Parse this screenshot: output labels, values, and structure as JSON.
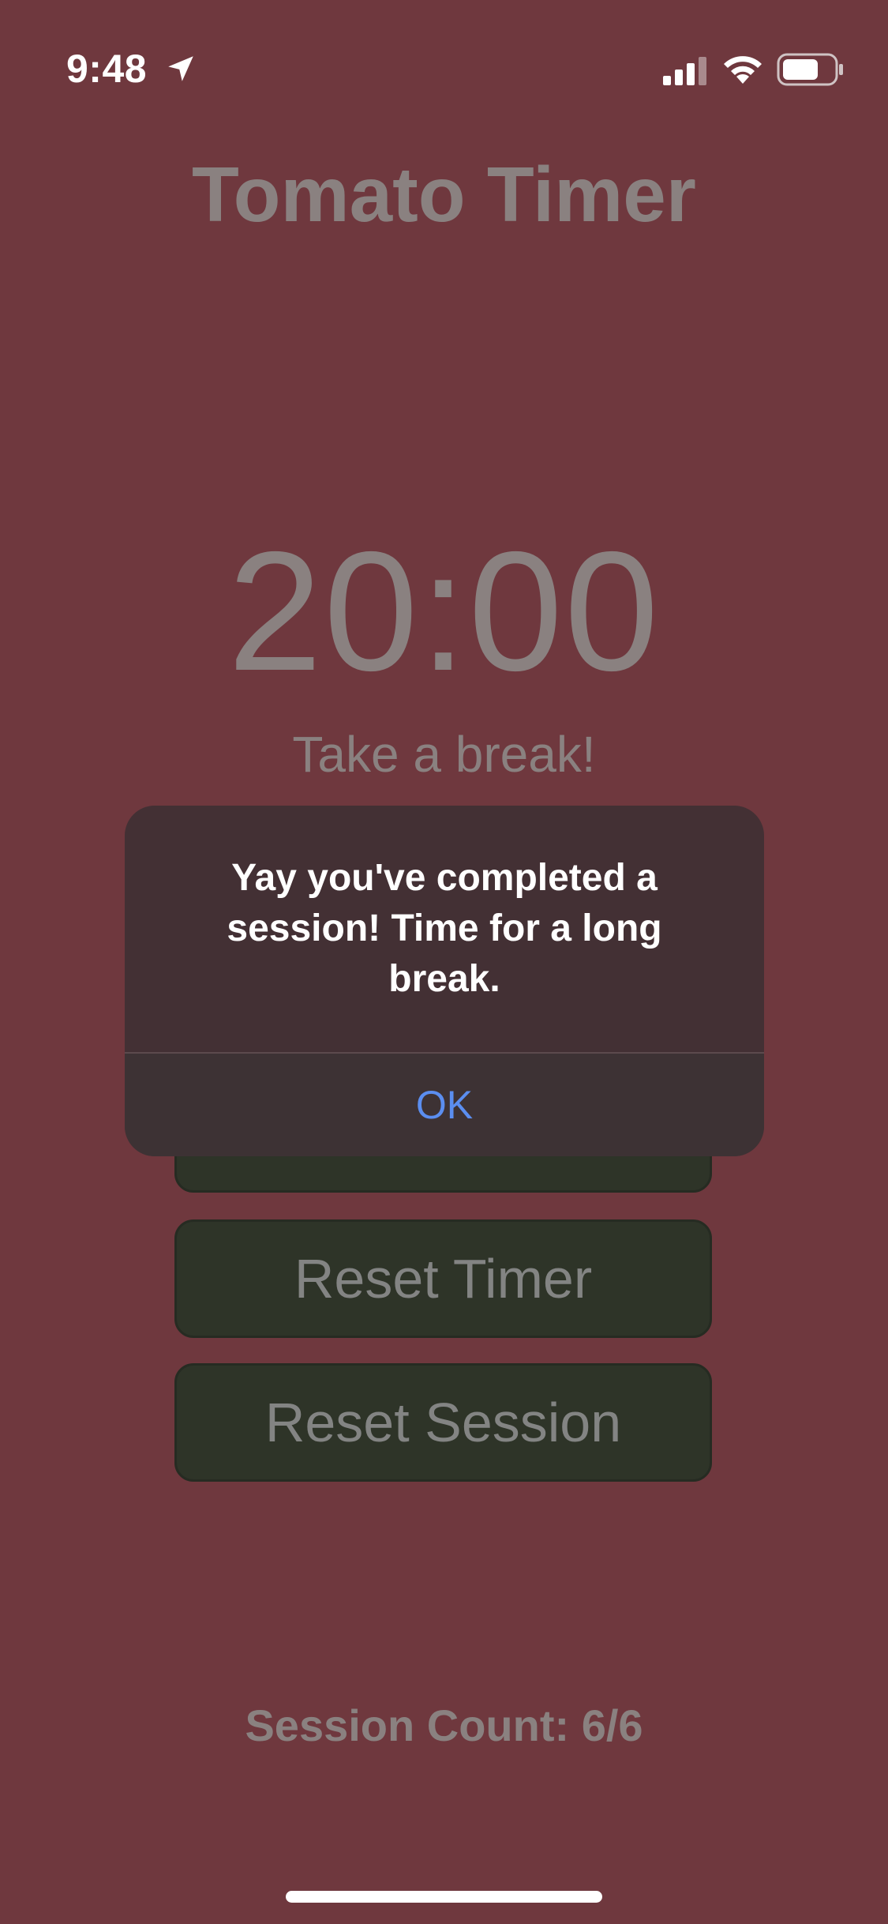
{
  "status_bar": {
    "time": "9:48",
    "icons": [
      "location-arrow-icon",
      "cellular-signal-icon",
      "wifi-icon",
      "battery-icon"
    ]
  },
  "app": {
    "title": "Tomato Timer",
    "timer": "20:00",
    "message": "Take a break!",
    "buttons": {
      "reset_timer": "Reset Timer",
      "reset_session": "Reset Session"
    },
    "session_count": "Session Count: 6/6"
  },
  "alert": {
    "message": "Yay you've completed a session! Time for a long break.",
    "ok_label": "OK"
  },
  "colors": {
    "background": "#6f383e",
    "button": "#2e3428",
    "alert": "#433034",
    "accent": "#5b8ef0"
  }
}
